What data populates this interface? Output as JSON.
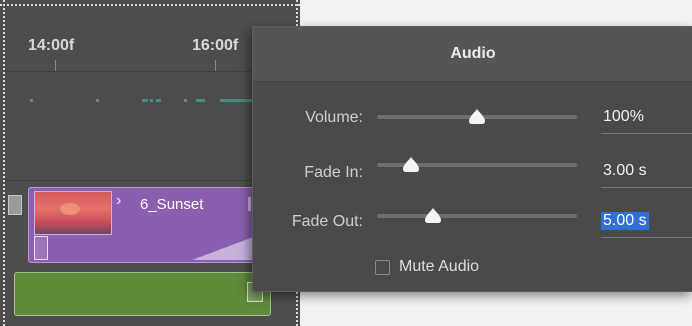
{
  "timeline": {
    "ruler_labels": [
      "14:00f",
      "16:00f"
    ],
    "clip_name": "6_Sunset",
    "clip_chevron": "›"
  },
  "audio_panel": {
    "title": "Audio",
    "volume": {
      "label": "Volume:",
      "value": "100%",
      "level": 0.5
    },
    "fade_in": {
      "label": "Fade In:",
      "value": "3.00 s",
      "level": 0.17
    },
    "fade_out": {
      "label": "Fade Out:",
      "value": "5.00 s",
      "level": 0.28,
      "selected": true
    },
    "mute": {
      "label": "Mute Audio",
      "checked": false
    }
  },
  "colors": {
    "panel_bg": "#4a4a4a",
    "video_clip": "#8a5fb0",
    "audio_clip": "#5f8b3b",
    "selection": "#2f6fd6"
  },
  "icons": [
    "chevron-right-icon",
    "slider-thumb-icon",
    "checkbox-icon"
  ]
}
